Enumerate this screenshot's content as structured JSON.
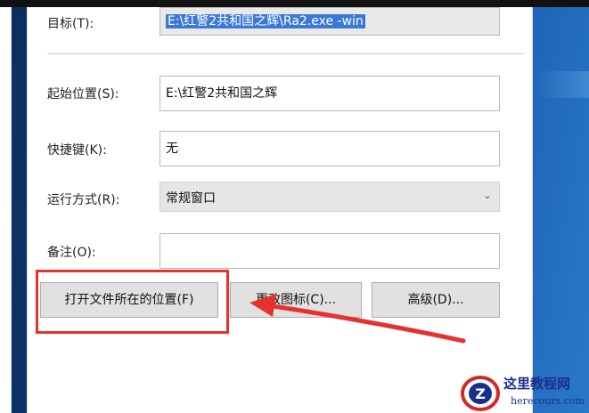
{
  "window": {
    "target_label": "目标(T):",
    "target_value": "E:\\红警2共和国之辉\\Ra2.exe -win",
    "start_in_label": "起始位置(S):",
    "start_in_value": "E:\\红警2共和国之辉",
    "shortcut_key_label": "快捷键(K):",
    "shortcut_key_value": "无",
    "run_label": "运行方式(R):",
    "run_value": "常规窗口",
    "comment_label": "备注(O):",
    "comment_value": ""
  },
  "buttons": {
    "open_location": "打开文件所在的位置(F)",
    "change_icon": "更改图标(C)...",
    "advanced": "高级(D)..."
  },
  "annotation": {
    "highlight_color": "#e5322d",
    "arrow_color": "#e5322d"
  },
  "watermark": {
    "title": "这里教程网",
    "url": "herecours.com"
  }
}
